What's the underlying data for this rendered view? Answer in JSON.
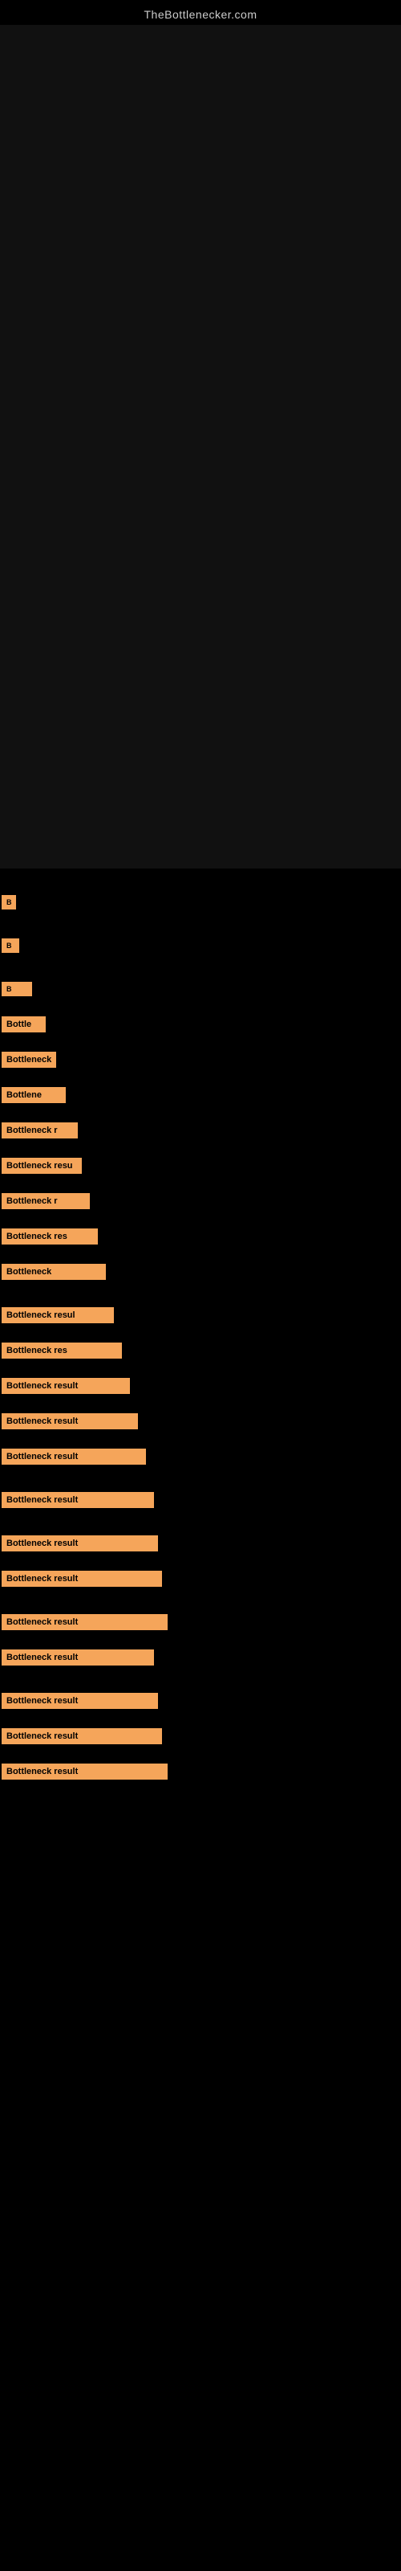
{
  "site": {
    "title": "TheBottlenecker.com"
  },
  "results": [
    {
      "id": 1,
      "label": "B",
      "width_class": "w-tiny"
    },
    {
      "id": 2,
      "label": "B",
      "width_class": "w-xs"
    },
    {
      "id": 3,
      "label": "B",
      "width_class": "w-sm"
    },
    {
      "id": 4,
      "label": "Bottle",
      "width_class": "w-md1"
    },
    {
      "id": 5,
      "label": "Bottleneck",
      "width_class": "w-md2"
    },
    {
      "id": 6,
      "label": "Bottlene",
      "width_class": "w-md3"
    },
    {
      "id": 7,
      "label": "Bottleneck r",
      "width_class": "w-md4"
    },
    {
      "id": 8,
      "label": "Bottleneck resu",
      "width_class": "w-md5"
    },
    {
      "id": 9,
      "label": "Bottleneck r",
      "width_class": "w-md6"
    },
    {
      "id": 10,
      "label": "Bottleneck res",
      "width_class": "w-lg1"
    },
    {
      "id": 11,
      "label": "Bottleneck",
      "width_class": "w-lg2"
    },
    {
      "id": 12,
      "label": "Bottleneck resul",
      "width_class": "w-lg3"
    },
    {
      "id": 13,
      "label": "Bottleneck res",
      "width_class": "w-lg4"
    },
    {
      "id": 14,
      "label": "Bottleneck result",
      "width_class": "w-lg5"
    },
    {
      "id": 15,
      "label": "Bottleneck result",
      "width_class": "w-lg6"
    },
    {
      "id": 16,
      "label": "Bottleneck result",
      "width_class": "w-lg7"
    },
    {
      "id": 17,
      "label": "Bottleneck result",
      "width_class": "w-full1"
    },
    {
      "id": 18,
      "label": "Bottleneck result",
      "width_class": "w-full2"
    },
    {
      "id": 19,
      "label": "Bottleneck result",
      "width_class": "w-full3"
    },
    {
      "id": 20,
      "label": "Bottleneck result",
      "width_class": "w-full4"
    },
    {
      "id": 21,
      "label": "Bottleneck result",
      "width_class": "w-full1"
    },
    {
      "id": 22,
      "label": "Bottleneck result",
      "width_class": "w-full2"
    },
    {
      "id": 23,
      "label": "Bottleneck result",
      "width_class": "w-full3"
    },
    {
      "id": 24,
      "label": "Bottleneck result",
      "width_class": "w-full4"
    }
  ]
}
